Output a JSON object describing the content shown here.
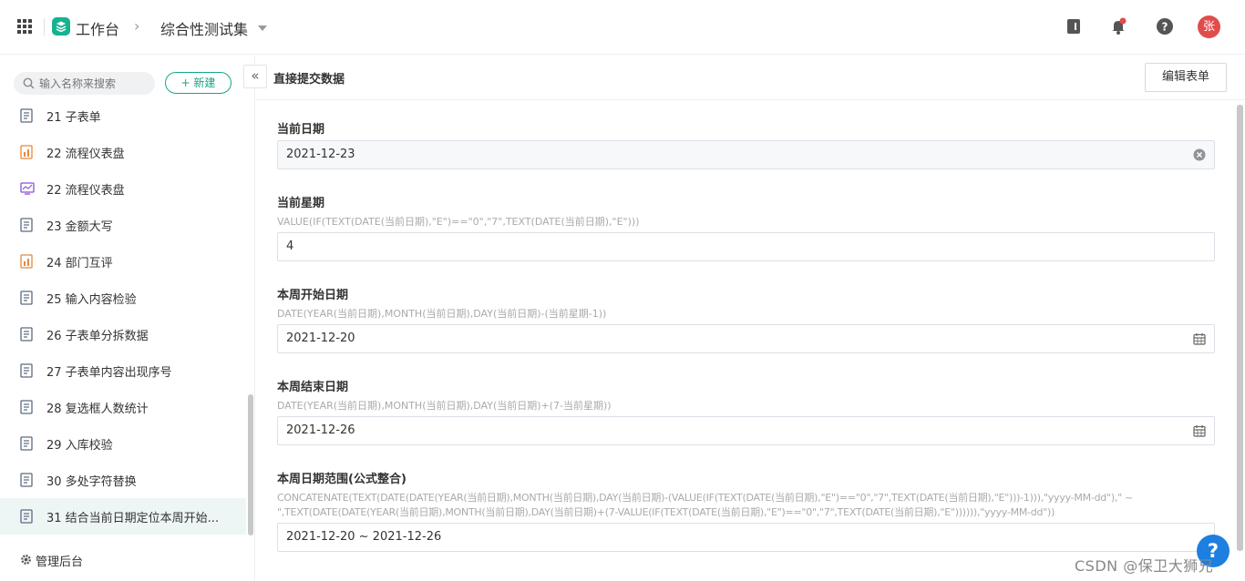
{
  "topbar": {
    "app_name": "工作台",
    "chevron": "›",
    "current_title": "综合性测试集",
    "avatar_text": "张"
  },
  "sidebar": {
    "search_placeholder": "输入名称来搜索",
    "new_button": "+ 新建",
    "items": [
      {
        "label": "21 子表单",
        "icon": "form-icon"
      },
      {
        "label": "22 流程仪表盘",
        "icon": "dashboard-icon"
      },
      {
        "label": "22 流程仪表盘",
        "icon": "report-icon"
      },
      {
        "label": "23 金额大写",
        "icon": "form-icon"
      },
      {
        "label": "24 部门互评",
        "icon": "dashboard-icon"
      },
      {
        "label": "25 输入内容检验",
        "icon": "form-icon"
      },
      {
        "label": "26 子表单分拆数据",
        "icon": "form-icon"
      },
      {
        "label": "27 子表单内容出现序号",
        "icon": "form-icon"
      },
      {
        "label": "28 复选框人数统计",
        "icon": "form-icon"
      },
      {
        "label": "29 入库校验",
        "icon": "form-icon"
      },
      {
        "label": "30 多处字符替换",
        "icon": "form-icon"
      },
      {
        "label": "31 结合当前日期定位本周开始...",
        "icon": "form-icon"
      }
    ],
    "admin_label": "管理后台",
    "collapse_icon": "«"
  },
  "main": {
    "title": "直接提交数据",
    "edit_button": "编辑表单",
    "fields": [
      {
        "label": "当前日期",
        "formula": "",
        "value": "2021-12-23",
        "suffix": "clear-icon"
      },
      {
        "label": "当前星期",
        "formula": "VALUE(IF(TEXT(DATE(当前日期),\"E\")==\"0\",\"7\",TEXT(DATE(当前日期),\"E\")))",
        "value": "4",
        "suffix": ""
      },
      {
        "label": "本周开始日期",
        "formula": "DATE(YEAR(当前日期),MONTH(当前日期),DAY(当前日期)-(当前星期-1))",
        "value": "2021-12-20",
        "suffix": "calendar-icon"
      },
      {
        "label": "本周结束日期",
        "formula": "DATE(YEAR(当前日期),MONTH(当前日期),DAY(当前日期)+(7-当前星期))",
        "value": "2021-12-26",
        "suffix": "calendar-icon"
      },
      {
        "label": "本周日期范围(公式整合)",
        "formula_line1": "CONCATENATE(TEXT(DATE(DATE(YEAR(当前日期),MONTH(当前日期),DAY(当前日期)-(VALUE(IF(TEXT(DATE(当前日期),\"E\")==\"0\",\"7\",TEXT(DATE(当前日期),\"E\")))-1))),\"yyyy-MM-dd\"),\" ~",
        "formula_line2": "\",TEXT(DATE(DATE(YEAR(当前日期),MONTH(当前日期),DAY(当前日期)+(7-VALUE(IF(TEXT(DATE(当前日期),\"E\")==\"0\",\"7\",TEXT(DATE(当前日期),\"E\")))))),\"yyyy-MM-dd\"))",
        "value": "2021-12-20 ~ 2021-12-26",
        "suffix": ""
      }
    ]
  },
  "help_button": "?",
  "watermark": "CSDN @保卫大狮兄",
  "colors": {
    "accent": "#17a589",
    "avatar": "#e04c4c",
    "help": "#1d7fe0"
  }
}
